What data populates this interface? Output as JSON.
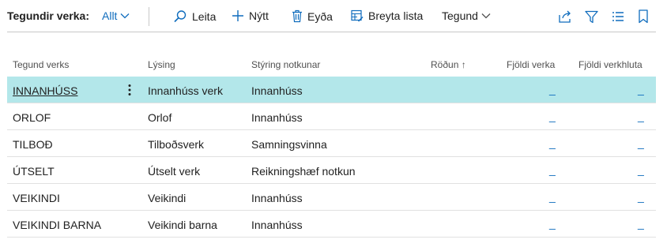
{
  "toolbar": {
    "title": "Tegundir verka:",
    "filter": "Allt",
    "search": "Leita",
    "new": "Nýtt",
    "delete": "Eyða",
    "edit_list": "Breyta lista",
    "category": "Tegund"
  },
  "columns": {
    "type": "Tegund verks",
    "description": "Lýsing",
    "usage_control": "Stýring notkunar",
    "order": "Röðun ↑",
    "job_count": "Fjöldi verka",
    "part_count": "Fjöldi verkhluta"
  },
  "rows": [
    {
      "type": "INNANHÚSS",
      "description": "Innanhúss verk",
      "usage_control": "Innanhúss",
      "job_count": "_",
      "part_count": "_"
    },
    {
      "type": "ORLOF",
      "description": "Orlof",
      "usage_control": "Innanhúss",
      "job_count": "_",
      "part_count": "_"
    },
    {
      "type": "TILBOÐ",
      "description": "Tilboðsverk",
      "usage_control": "Samningsvinna",
      "job_count": "_",
      "part_count": "_"
    },
    {
      "type": "ÚTSELT",
      "description": "Útselt verk",
      "usage_control": "Reikningshæf notkun",
      "job_count": "_",
      "part_count": "_"
    },
    {
      "type": "VEIKINDI",
      "description": "Veikindi",
      "usage_control": "Innanhúss",
      "job_count": "_",
      "part_count": "_"
    },
    {
      "type": "VEIKINDI BARNA",
      "description": "Veikindi barna",
      "usage_control": "Innanhúss",
      "job_count": "_",
      "part_count": "_"
    }
  ],
  "colors": {
    "accent": "#0f6cbd",
    "selected_row": "#b3e7ea"
  },
  "icons": [
    "search-icon",
    "plus-icon",
    "trash-icon",
    "edit-list-icon",
    "chevron-down-icon",
    "share-icon",
    "filter-icon",
    "list-view-icon",
    "bookmark-icon",
    "more-vertical-icon"
  ]
}
